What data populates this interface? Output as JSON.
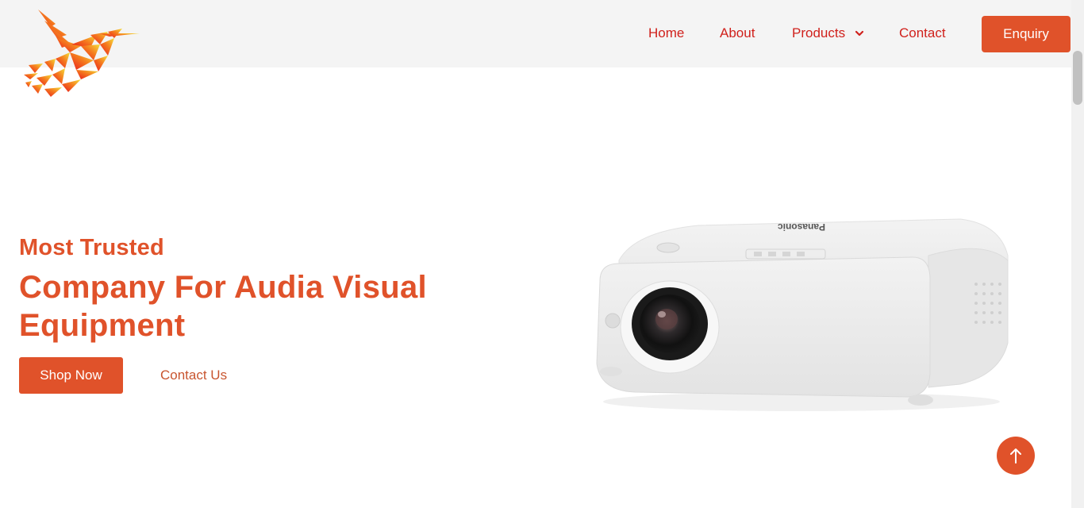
{
  "header": {
    "nav": {
      "home": "Home",
      "about": "About",
      "products": "Products",
      "contact": "Contact"
    },
    "enquiry_label": "Enquiry"
  },
  "hero": {
    "eyebrow": "Most Trusted",
    "headline": "Company For Audia Visual Equipment",
    "shop_label": "Shop Now",
    "contact_label": "Contact Us",
    "projector_brand": "Panasonic"
  },
  "icons": {
    "logo": "bird-logo-icon",
    "products_dropdown": "chevron-down-icon",
    "scroll_top": "arrow-up-icon"
  },
  "colors": {
    "accent": "#e0522a",
    "nav_text": "#d0211c",
    "header_bg": "#f4f4f4"
  }
}
